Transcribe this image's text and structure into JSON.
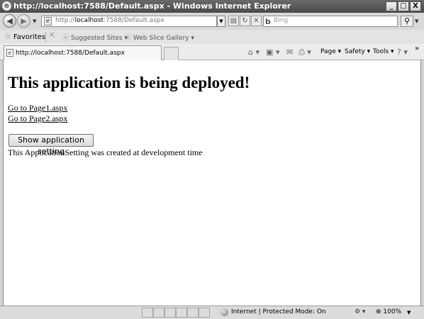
{
  "window": {
    "title": "http://localhost:7588/Default.aspx - Windows Internet Explorer",
    "minimize": "_",
    "maximize": "□",
    "close": "X"
  },
  "nav": {
    "url_prefix": "http://",
    "url_host": "localhost",
    "url_rest": ":7588/Default.aspx",
    "search_placeholder": "Bing",
    "search_logo": "b"
  },
  "favorites": {
    "label": "Favorites",
    "items": [
      "Suggested Sites ▾",
      "Web Slice Gallery ▾"
    ]
  },
  "tab": {
    "title": "http://localhost:7588/Default.aspx"
  },
  "commands": {
    "page": "Page ▾",
    "safety": "Safety ▾",
    "tools": "Tools ▾",
    "chevron": "»"
  },
  "content": {
    "heading": "This application is being deployed!",
    "links": [
      "Go to Page1.aspx",
      "Go to Page2.aspx"
    ],
    "button": "Show application setting",
    "message": "This ApplicationSetting was created at development time"
  },
  "statusbar": {
    "zone": "Internet | Protected Mode: On",
    "zoom": "100%"
  },
  "icons": {
    "back": "back-arrow-icon",
    "forward": "forward-arrow-icon",
    "refresh": "refresh-icon",
    "stop": "stop-icon",
    "search": "search-icon",
    "home": "home-icon",
    "feeds": "feeds-icon",
    "mail": "mail-icon",
    "print": "print-icon",
    "help": "help-icon",
    "globe": "globe-icon"
  }
}
